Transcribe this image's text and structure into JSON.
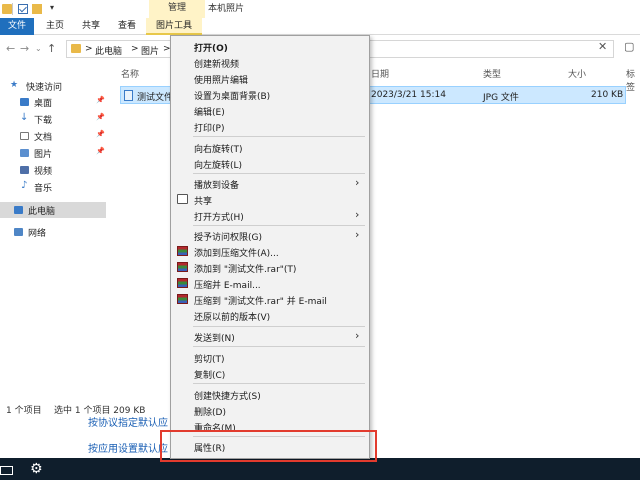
{
  "titlebar": {
    "manage_tab": "管理",
    "window_title": "本机照片"
  },
  "ribbon": {
    "tabs": [
      "文件",
      "主页",
      "共享",
      "查看",
      "图片工具"
    ]
  },
  "address": {
    "breadcrumb": [
      "此电脑",
      "图片"
    ],
    "sep": ">"
  },
  "nav": {
    "items": [
      "快速访问",
      "桌面",
      "下载",
      "文档",
      "图片",
      "视频",
      "音乐",
      "此电脑",
      "网络"
    ],
    "pin_icon": "pin-icon"
  },
  "filelist": {
    "headers": [
      "名称",
      "日期",
      "类型",
      "大小",
      "标签"
    ],
    "row": {
      "name": "测试文件",
      "date": "2023/3/21 15:14",
      "type": "JPG 文件",
      "size": "210 KB"
    }
  },
  "status": {
    "count": "1 个项目",
    "selected": "选中 1 个项目  209 KB"
  },
  "background_links": [
    "按协议指定默认应",
    "按应用设置默认应"
  ],
  "context_menu": {
    "items": [
      {
        "label": "打开(O)",
        "bold": true
      },
      {
        "label": "创建新视频"
      },
      {
        "label": "使用照片编辑"
      },
      {
        "label": "设置为桌面背景(B)"
      },
      {
        "label": "编辑(E)"
      },
      {
        "label": "打印(P)"
      },
      {
        "label": "向右旋转(T)"
      },
      {
        "label": "向左旋转(L)"
      },
      {
        "label": "播放到设备",
        "submenu": true
      },
      {
        "label": "共享",
        "icon": "share-icon"
      },
      {
        "label": "打开方式(H)",
        "submenu": true
      },
      {
        "label": "授予访问权限(G)",
        "submenu": true
      },
      {
        "label": "添加到压缩文件(A)...",
        "icon": "winrar-icon"
      },
      {
        "label": "添加到 \"测试文件.rar\"(T)",
        "icon": "winrar-icon"
      },
      {
        "label": "压缩并 E-mail...",
        "icon": "winrar-icon"
      },
      {
        "label": "压缩到 \"测试文件.rar\" 并 E-mail",
        "icon": "winrar-icon"
      },
      {
        "label": "还原以前的版本(V)"
      },
      {
        "label": "发送到(N)",
        "submenu": true
      },
      {
        "label": "剪切(T)"
      },
      {
        "label": "复制(C)"
      },
      {
        "label": "创建快捷方式(S)"
      },
      {
        "label": "删除(D)"
      },
      {
        "label": "重命名(M)"
      },
      {
        "label": "属性(R)"
      }
    ],
    "submenu_arrow": "›",
    "highlight_color": "#e23b2e"
  },
  "taskbar": {
    "icons": [
      "mail-icon",
      "gear-icon"
    ]
  },
  "colors": {
    "file_tab": "#1f6fbd",
    "picture_tools": "#fff3c7",
    "selection": "#cce8ff",
    "taskbar": "#0f1e2c"
  }
}
